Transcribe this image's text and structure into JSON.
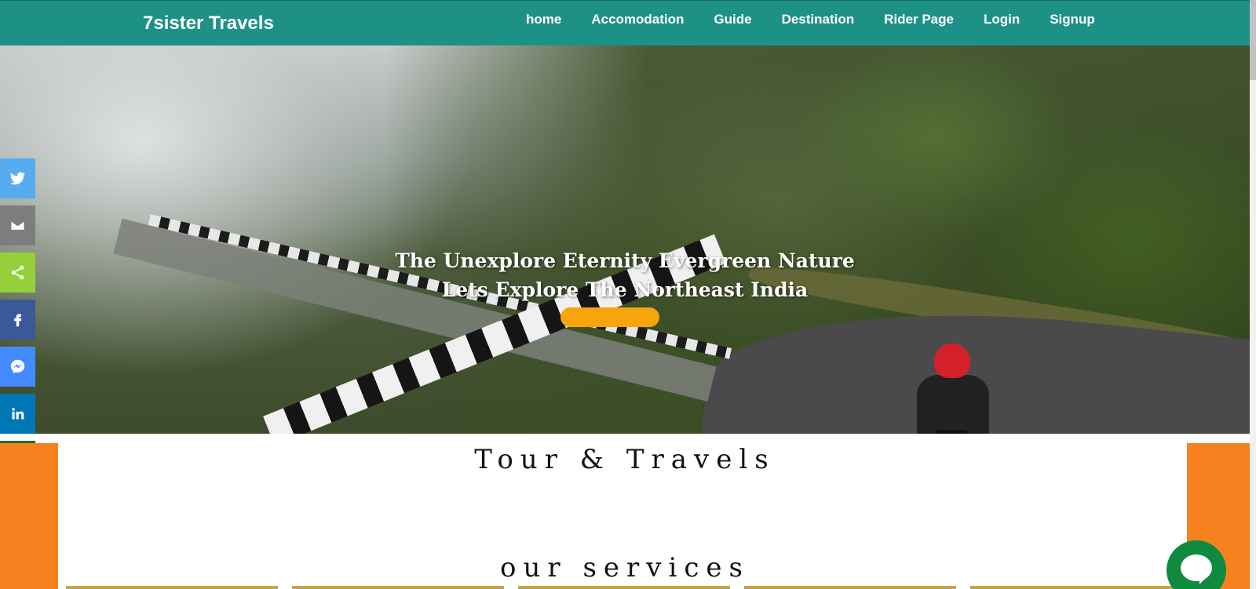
{
  "navbar": {
    "brand": "7sister Travels",
    "links": [
      "home",
      "Accomodation",
      "Guide",
      "Destination",
      "Rider Page",
      "Login",
      "Signup"
    ],
    "background": "#1e9186"
  },
  "hero": {
    "line1": "The Unexplore Eternity Evergreen Nature",
    "line2": "Lets Explore The Northeast India",
    "button_color": "#f7a50c"
  },
  "social": {
    "items": [
      {
        "icon": "twitter-icon",
        "color": "#55acee"
      },
      {
        "icon": "email-icon",
        "color": "#7d7d7d"
      },
      {
        "icon": "share-icon",
        "color": "#95d03a"
      },
      {
        "icon": "facebook-icon",
        "color": "#3b5998"
      },
      {
        "icon": "messenger-icon",
        "color": "#448aff"
      },
      {
        "icon": "linkedin-icon",
        "color": "#0077b5"
      },
      {
        "icon": "copy-icon",
        "color": "#1c6f2f"
      },
      {
        "icon": "print-icon",
        "color": "#222222"
      },
      {
        "icon": "whatsapp-icon",
        "color": "#25d366"
      }
    ]
  },
  "section": {
    "title": "Tour & Travels",
    "services_title": "our services",
    "accent": "#f5821f",
    "card_border": "#c8a342"
  },
  "chat": {
    "icon": "chat-icon",
    "color": "#0f8a3f"
  }
}
